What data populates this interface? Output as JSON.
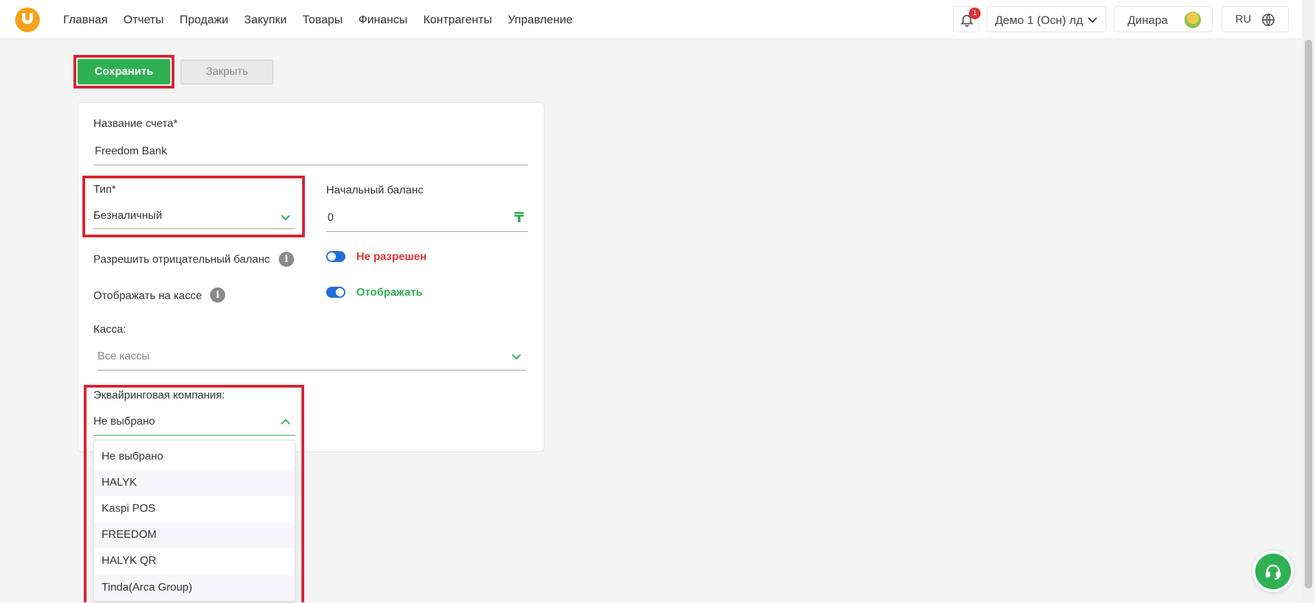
{
  "header": {
    "nav": [
      "Главная",
      "Отчеты",
      "Продажи",
      "Закупки",
      "Товары",
      "Финансы",
      "Контрагенты",
      "Управление"
    ],
    "notifications_count": "1",
    "company": "Демо 1 (Осн) лд",
    "user": "Динара",
    "language": "RU"
  },
  "actions": {
    "save_label": "Сохранить",
    "close_label": "Закрыть"
  },
  "form": {
    "account_name_label": "Название счета*",
    "account_name_value": "Freedom Bank",
    "type_label": "Тип*",
    "type_value": "Безналичный",
    "initial_balance_label": "Начальный баланс",
    "initial_balance_value": "0",
    "currency_symbol": "₸",
    "allow_negative_label": "Разрешить отрицательный баланс",
    "allow_negative_status": "Не разрешен",
    "show_at_register_label": "Отображать на кассе",
    "show_at_register_status": "Отображать",
    "register_label": "Касса:",
    "register_placeholder": "Все кассы",
    "acquiring_label": "Эквайринговая компания:",
    "acquiring_value": "Не выбрано",
    "acquiring_options": [
      "Не выбрано",
      "HALYK",
      "Kaspi POS",
      "FREEDOM",
      "HALYK QR",
      "Tinda(Arca Group)"
    ]
  },
  "colors": {
    "accent_green": "#2fb153",
    "highlight_red": "#d8232f",
    "toggle_blue": "#1e6fd9",
    "status_red": "#e03131",
    "logo_orange": "#f7a21b"
  },
  "icons": [
    "logo-icon",
    "bell-icon",
    "chevron-down-icon",
    "avatar",
    "globe-icon",
    "info-icon",
    "chevron-up-icon",
    "headset-icon"
  ]
}
